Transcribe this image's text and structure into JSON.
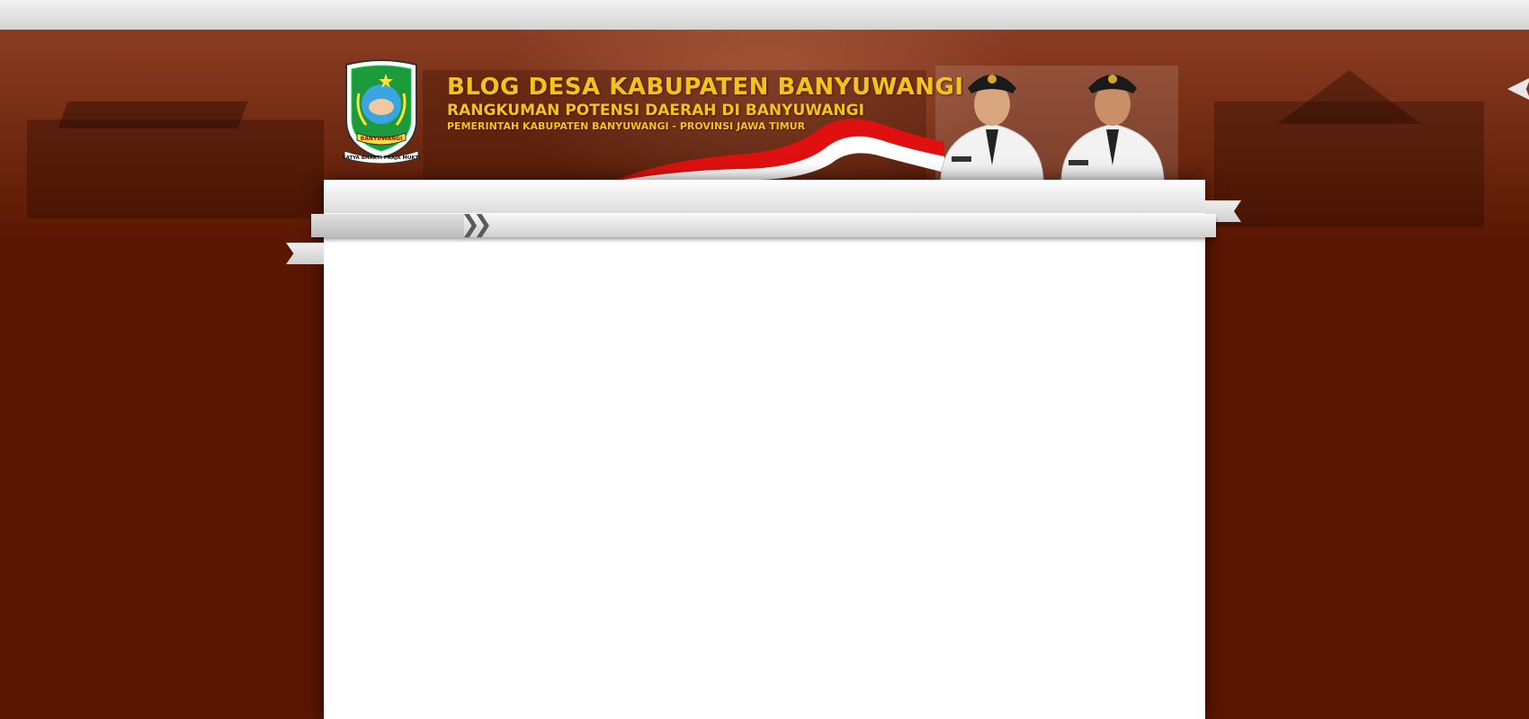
{
  "header": {
    "title": "BLOG DESA KABUPATEN BANYUWANGI",
    "subtitle": "RANGKUMAN POTENSI DAERAH DI BANYUWANGI",
    "tagline": "PEMERINTAH KABUPATEN BANYUWANGI - PROVINSI JAWA TIMUR",
    "logo": {
      "banner_text": "BANYUWANGI",
      "motto": "SATYA BHAKTI PRAJA MUKTI"
    }
  },
  "navbar": {
    "icon": "double-chevron-right-icon"
  },
  "colors": {
    "background": "#5a1600",
    "title": "#f5c21b",
    "content": "#ffffff"
  }
}
